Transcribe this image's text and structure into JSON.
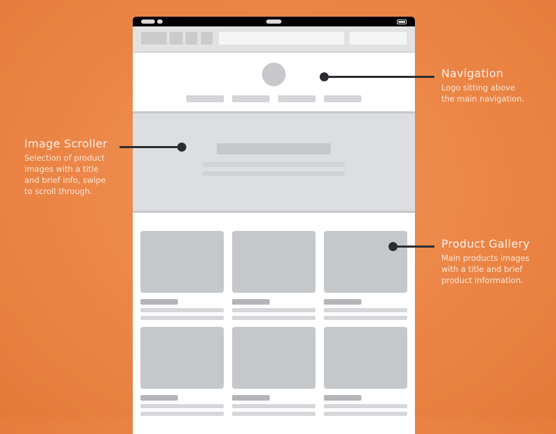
{
  "diagram": {
    "type": "mobile-wireframe-annotation",
    "colors": {
      "background": "#eb8546",
      "callout": "#2a2c30",
      "wireframe_block": "#c5c8cb",
      "label_text": "#fdf1e6"
    },
    "wireframe": {
      "nav_items_count": 4,
      "gallery_columns": 3,
      "gallery_rows_visible": 2
    },
    "callouts": [
      {
        "id": "navigation",
        "title": "Navigation",
        "description_lines": [
          "Logo sitting above",
          "the main navigation."
        ]
      },
      {
        "id": "image-scroller",
        "title": "Image Scroller",
        "description_lines": [
          "Selection of product",
          "images with a title",
          "and brief info, swipe",
          "to scroll through."
        ]
      },
      {
        "id": "product-gallery",
        "title": "Product Gallery",
        "description_lines": [
          "Main products images",
          "with a title and brief",
          "product information."
        ]
      }
    ]
  }
}
